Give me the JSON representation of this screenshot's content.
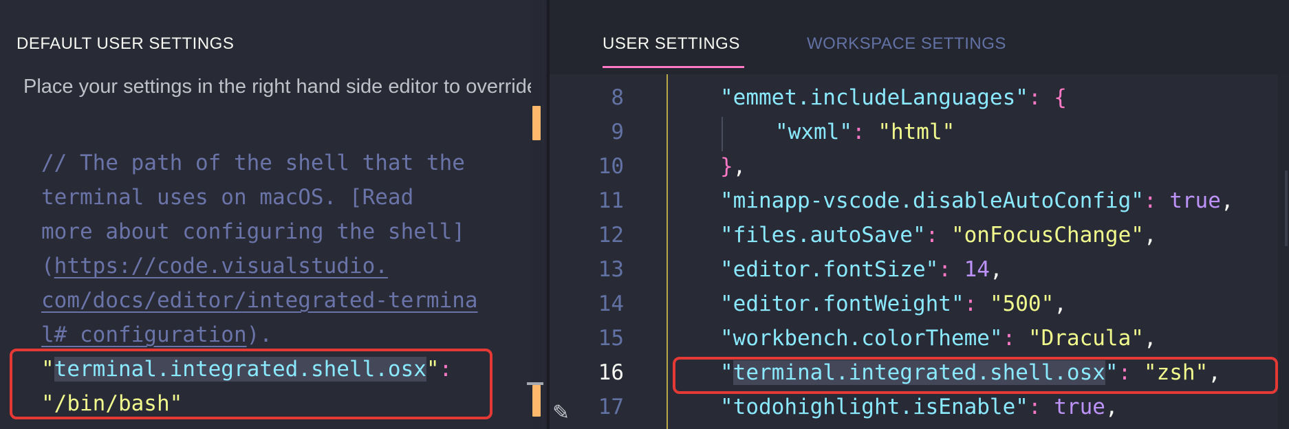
{
  "left_pane": {
    "title": "DEFAULT USER SETTINGS",
    "info": "Place your settings in the right hand side editor to override.",
    "comment": {
      "line1": "// The path of the shell that the",
      "line2": "terminal uses on macOS. [Read",
      "line3": "more about configuring the shell]",
      "line4_open": "(",
      "line4_link": "https://code.visualstudio.",
      "line5_link": "com/docs/editor/integrated-termina",
      "line6_link": "l#_configuration",
      "line6_close": ")."
    },
    "setting": {
      "key_quote_open": "\"",
      "key": "terminal.integrated.shell.osx",
      "key_quote_close": "\"",
      "colon": ":",
      "value": "\"/bin/bash\""
    }
  },
  "right_pane": {
    "tabs": [
      {
        "label": "USER SETTINGS",
        "active": true
      },
      {
        "label": "WORKSPACE SETTINGS",
        "active": false
      }
    ],
    "lines": [
      {
        "num": "8",
        "key": "\"emmet.includeLanguages\"",
        "sep": ": ",
        "value": "{",
        "value_type": "brace",
        "trail": ""
      },
      {
        "num": "9",
        "key": "\"wxml\"",
        "sep": ": ",
        "value": "\"html\"",
        "value_type": "string",
        "trail": ""
      },
      {
        "num": "10",
        "key": "",
        "sep": "",
        "value": "}",
        "value_type": "brace",
        "trail": ","
      },
      {
        "num": "11",
        "key": "\"minapp-vscode.disableAutoConfig\"",
        "sep": ": ",
        "value": "true",
        "value_type": "keyword",
        "trail": ","
      },
      {
        "num": "12",
        "key": "\"files.autoSave\"",
        "sep": ": ",
        "value": "\"onFocusChange\"",
        "value_type": "string",
        "trail": ","
      },
      {
        "num": "13",
        "key": "\"editor.fontSize\"",
        "sep": ": ",
        "value": "14",
        "value_type": "number",
        "trail": ","
      },
      {
        "num": "14",
        "key": "\"editor.fontWeight\"",
        "sep": ": ",
        "value": "\"500\"",
        "value_type": "string",
        "trail": ","
      },
      {
        "num": "15",
        "key": "\"workbench.colorTheme\"",
        "sep": ": ",
        "value": "\"Dracula\"",
        "value_type": "string",
        "trail": ","
      },
      {
        "num": "16",
        "key_open": "\"",
        "key_sel": "terminal.integrated.shell.osx",
        "key_close": "\"",
        "sep": ": ",
        "value": "\"zsh\"",
        "value_type": "string",
        "trail": ","
      },
      {
        "num": "17",
        "key": "\"todohighlight.isEnable\"",
        "sep": ": ",
        "value": "true",
        "value_type": "keyword",
        "trail": ","
      }
    ]
  },
  "colors": {
    "background": "#282a36",
    "tab_underline": "#ff79c6",
    "highlight_box": "#e53935",
    "key": "#8be9fd",
    "string": "#f1fa8c",
    "keyword": "#bd93f9",
    "punctuation": "#ff79c6",
    "comment": "#6272a4"
  }
}
